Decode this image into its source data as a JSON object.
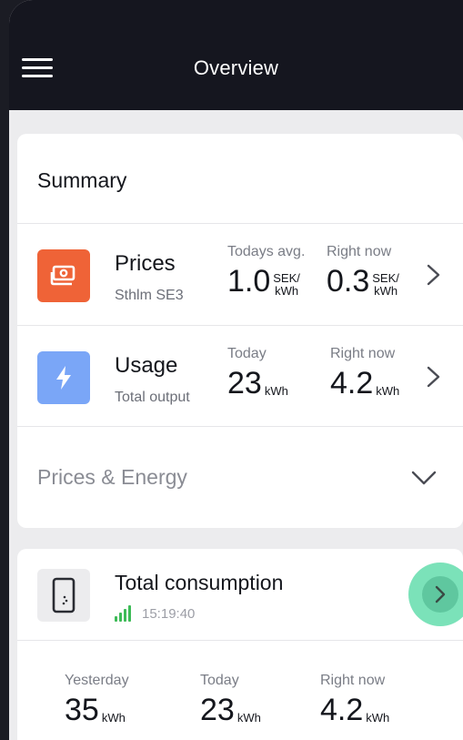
{
  "header": {
    "title": "Overview"
  },
  "summary": {
    "title": "Summary",
    "rows": [
      {
        "name": "Prices",
        "subtitle": "Sthlm SE3",
        "icon": "money-icon",
        "icon_color": "#ef6337",
        "stats": [
          {
            "label": "Todays avg.",
            "value": "1.0",
            "unit_top": "SEK/",
            "unit_bottom": "kWh"
          },
          {
            "label": "Right now",
            "value": "0.3",
            "unit_top": "SEK/",
            "unit_bottom": "kWh"
          }
        ]
      },
      {
        "name": "Usage",
        "subtitle": "Total output",
        "icon": "lightning-icon",
        "icon_color": "#7aa6f7",
        "stats": [
          {
            "label": "Today",
            "value": "23",
            "unit": "kWh"
          },
          {
            "label": "Right now",
            "value": "4.2",
            "unit": "kWh"
          }
        ]
      }
    ],
    "expand": {
      "label": "Prices & Energy"
    }
  },
  "consumption": {
    "title": "Total consumption",
    "time": "15:19:40",
    "icon": "phone-device-icon",
    "signal_color": "#3dbb57",
    "stats": [
      {
        "label": "Yesterday",
        "value": "35",
        "unit": "kWh"
      },
      {
        "label": "Today",
        "value": "23",
        "unit": "kWh"
      },
      {
        "label": "Right now",
        "value": "4.2",
        "unit": "kWh"
      }
    ]
  }
}
